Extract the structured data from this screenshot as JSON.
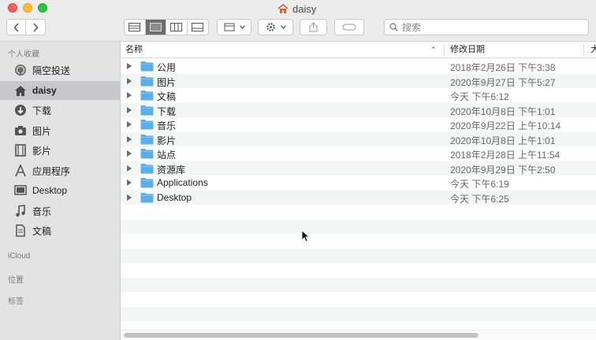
{
  "window": {
    "title": "daisy"
  },
  "toolbar": {
    "search_placeholder": "搜索",
    "icons": {
      "back": "chevron-left-icon",
      "forward": "chevron-right-icon",
      "view_list": "list-view-icon",
      "view_icons": "icon-view-icon",
      "view_columns": "column-view-icon",
      "view_gallery": "gallery-view-icon",
      "arrange": "group-icon",
      "action": "gear-icon",
      "share": "share-icon",
      "tag": "tag-icon",
      "search": "search-icon"
    }
  },
  "sidebar": {
    "favorites_header": "个人收藏",
    "items": [
      {
        "label": "隔空投送",
        "icon": "airdrop-icon"
      },
      {
        "label": "daisy",
        "icon": "home-icon",
        "selected": true
      },
      {
        "label": "下载",
        "icon": "download-icon"
      },
      {
        "label": "图片",
        "icon": "camera-icon"
      },
      {
        "label": "影片",
        "icon": "film-icon"
      },
      {
        "label": "应用程序",
        "icon": "applications-icon"
      },
      {
        "label": "Desktop",
        "icon": "desktop-icon"
      },
      {
        "label": "音乐",
        "icon": "music-icon"
      },
      {
        "label": "文稿",
        "icon": "document-icon"
      }
    ],
    "icloud_header": "iCloud",
    "locations_header": "位置",
    "tags_header": "标签"
  },
  "columns": {
    "name": "名称",
    "date_modified": "修改日期",
    "more": "大"
  },
  "files": [
    {
      "name": "公用",
      "date": "2018年2月26日 下午3:38"
    },
    {
      "name": "图片",
      "date": "2020年9月27日 下午5:27"
    },
    {
      "name": "文稿",
      "date": "今天 下午6:12"
    },
    {
      "name": "下载",
      "date": "2020年10月8日 下午1:01"
    },
    {
      "name": "音乐",
      "date": "2020年9月22日 上午10:14"
    },
    {
      "name": "影片",
      "date": "2020年10月8日 上午1:01"
    },
    {
      "name": "站点",
      "date": "2018年2月28日 上午11:54"
    },
    {
      "name": "资源库",
      "date": "2020年9月29日 下午2:50"
    },
    {
      "name": "Applications",
      "date": "今天 下午6:19"
    },
    {
      "name": "Desktop",
      "date": "今天 下午6:25"
    }
  ],
  "colors": {
    "folder": "#5aaee9",
    "selection": "#c8c8cb",
    "sidebar_bg": "#e3e3e4"
  }
}
